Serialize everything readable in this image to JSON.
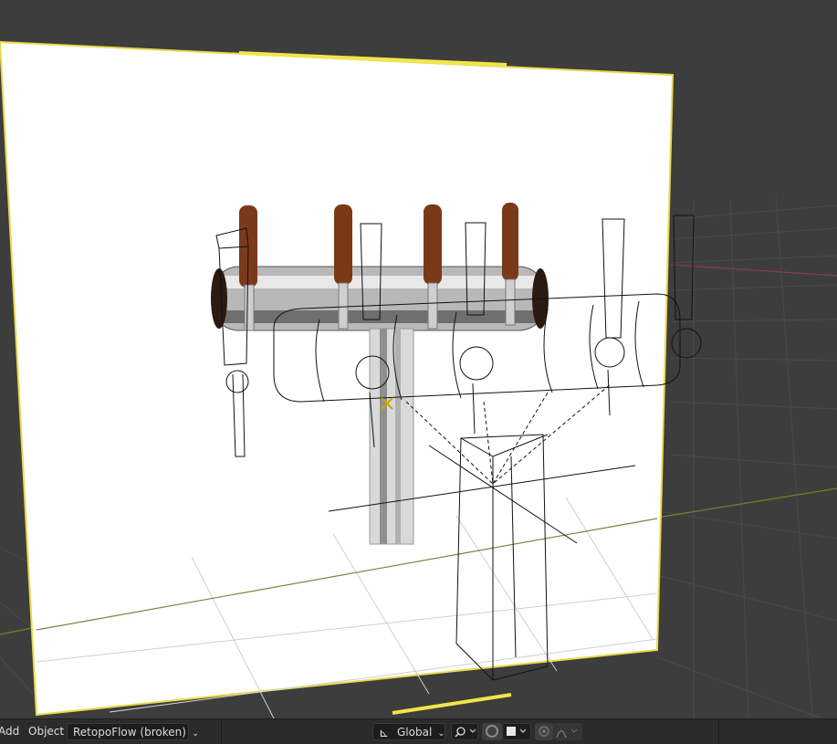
{
  "header": {
    "add_label": "Add",
    "object_label": "Object",
    "addon_dropdown": "RetopoFlow (broken)",
    "orientation_value": "Global"
  },
  "icons": {
    "transform_pivot": "transform-orientation-icon",
    "snap": "snap-icon",
    "snap_target": "magnet-icon",
    "color_swatch": "square-icon",
    "proportional": "proportional-edit-icon",
    "falloff": "falloff-curve-icon"
  },
  "colors": {
    "viewport_bg": "#3d3d3d",
    "header_bg": "#2b2b2b",
    "selection_yellow": "#f2e54a",
    "x_axis": "#8f3e3e",
    "y_axis": "#6a8a2c"
  }
}
